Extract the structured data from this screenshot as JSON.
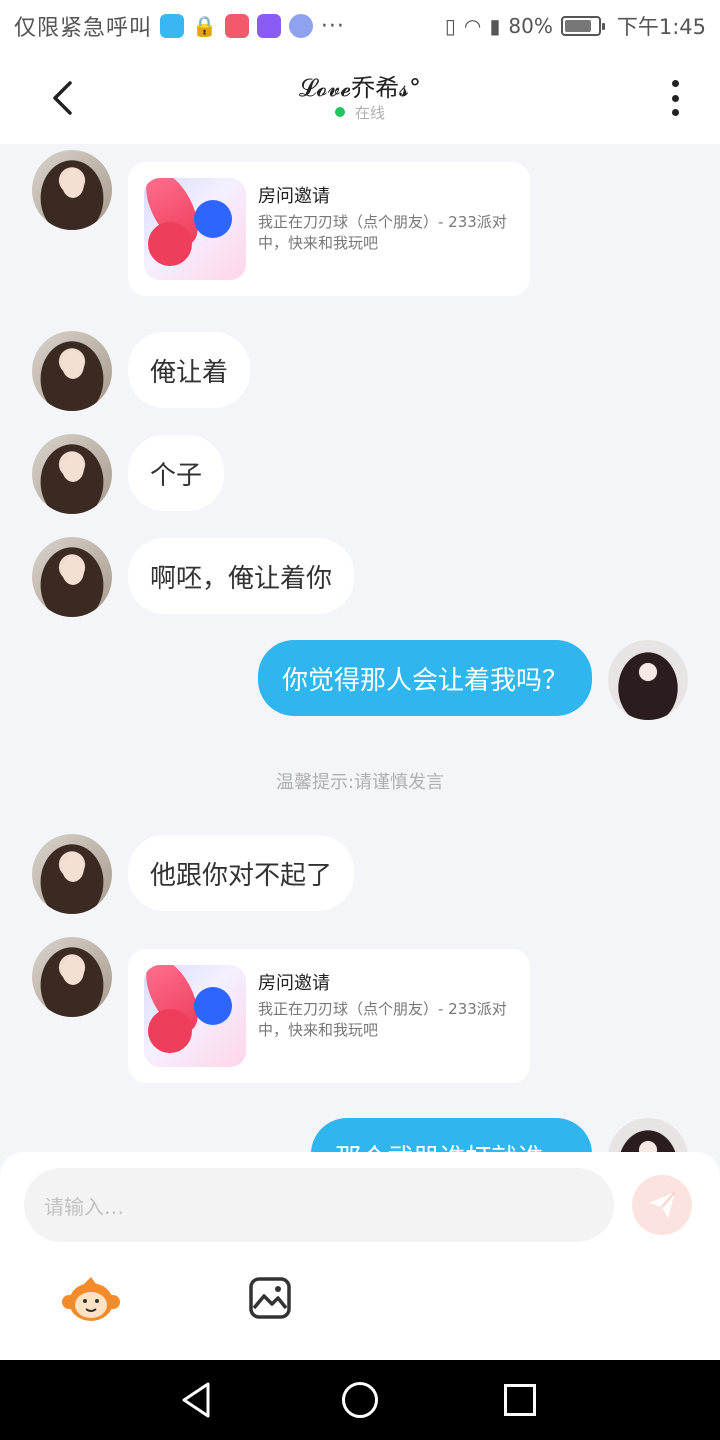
{
  "status_bar": {
    "carrier": "仅限紧急呼叫",
    "battery": "80%",
    "battery_level": 0.8,
    "time": "下午1:45",
    "overflow": "···"
  },
  "header": {
    "title": "𝓛𝓸𝓿𝓮乔希𝓼°",
    "status": "在线"
  },
  "messages": [
    {
      "type": "invite",
      "from": "them",
      "title": "房问邀请",
      "desc": "我正在刀刃球（点个朋友）- 233派对中，快来和我玩吧"
    },
    {
      "type": "text",
      "from": "them",
      "text": "俺让着"
    },
    {
      "type": "text",
      "from": "them",
      "text": "个子"
    },
    {
      "type": "text",
      "from": "them",
      "text": "啊呸，俺让着你"
    },
    {
      "type": "text",
      "from": "me",
      "text": "你觉得那人会让着我吗？"
    },
    {
      "type": "system",
      "text": "温馨提示:请谨慎发言"
    },
    {
      "type": "text",
      "from": "them",
      "text": "他跟你对不起了"
    },
    {
      "type": "invite",
      "from": "them",
      "title": "房问邀请",
      "desc": "我正在刀刃球（点个朋友）- 233派对中，快来和我玩吧"
    },
    {
      "type": "text",
      "from": "me",
      "text": "那个武器谁打就谁..."
    }
  ],
  "input": {
    "placeholder": "请输入…"
  },
  "colors": {
    "accent": "#2fb6ee",
    "online": "#22c55e",
    "send_button": "#fde3df",
    "background": "#f4f5f9"
  },
  "icons": [
    "back-arrow-icon",
    "more-vert-icon",
    "send-icon",
    "emoji-monkey-icon",
    "image-icon",
    "nav-back-icon",
    "nav-home-icon",
    "nav-recent-icon"
  ]
}
